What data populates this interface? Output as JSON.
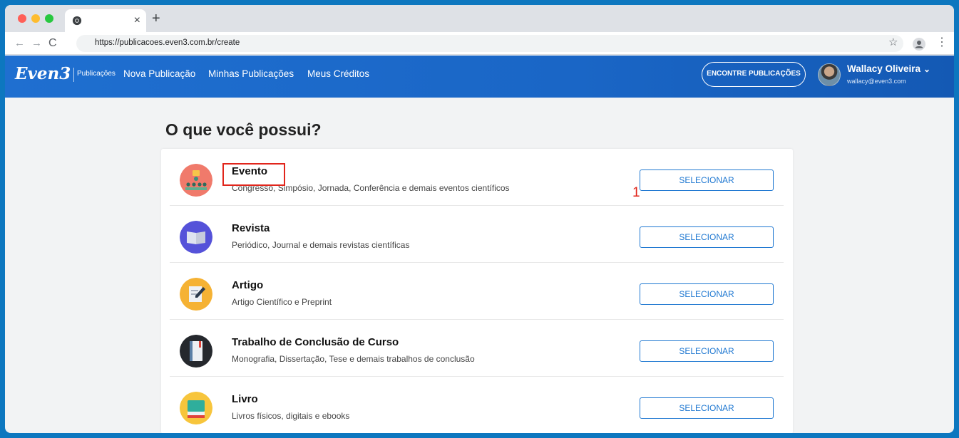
{
  "browser": {
    "tab_close": "×",
    "new_tab": "+",
    "back": "←",
    "forward": "→",
    "reload": "C",
    "url": "https://publicacoes.even3.com.br/create",
    "star": "☆",
    "menu": "⋮"
  },
  "header": {
    "logo": "Even3",
    "logo_sub": "Publicações",
    "nav": [
      "Nova Publicação",
      "Minhas Publicações",
      "Meus Créditos"
    ],
    "find_button": "ENCONTRE PUBLICAÇÕES",
    "user_name": "Wallacy Oliveira",
    "user_chevron": "⌄",
    "user_email": "wallacy@even3.com"
  },
  "main": {
    "title": "O que você possui?",
    "step_marker": "1",
    "options": [
      {
        "title": "Evento",
        "description": "Congresso, Simpósio, Jornada, Conferência e demais eventos científicos",
        "button": "SELECIONAR",
        "icon": "event-audience-icon"
      },
      {
        "title": "Revista",
        "description": "Periódico, Journal e demais revistas científicas",
        "button": "SELECIONAR",
        "icon": "journal-icon"
      },
      {
        "title": "Artigo",
        "description": "Artigo Científico e Preprint",
        "button": "SELECIONAR",
        "icon": "article-pencil-icon"
      },
      {
        "title": "Trabalho de Conclusão de Curso",
        "description": "Monografia, Dissertação, Tese e demais trabalhos de conclusão",
        "button": "SELECIONAR",
        "icon": "thesis-book-icon"
      },
      {
        "title": "Livro",
        "description": "Livros físicos, digitais e ebooks",
        "button": "SELECIONAR",
        "icon": "book-icon"
      }
    ]
  },
  "colors": {
    "frame": "#0d77bf",
    "header": "#1f6fd0",
    "accent": "#1f78d1",
    "annotation": "#e1251b"
  }
}
